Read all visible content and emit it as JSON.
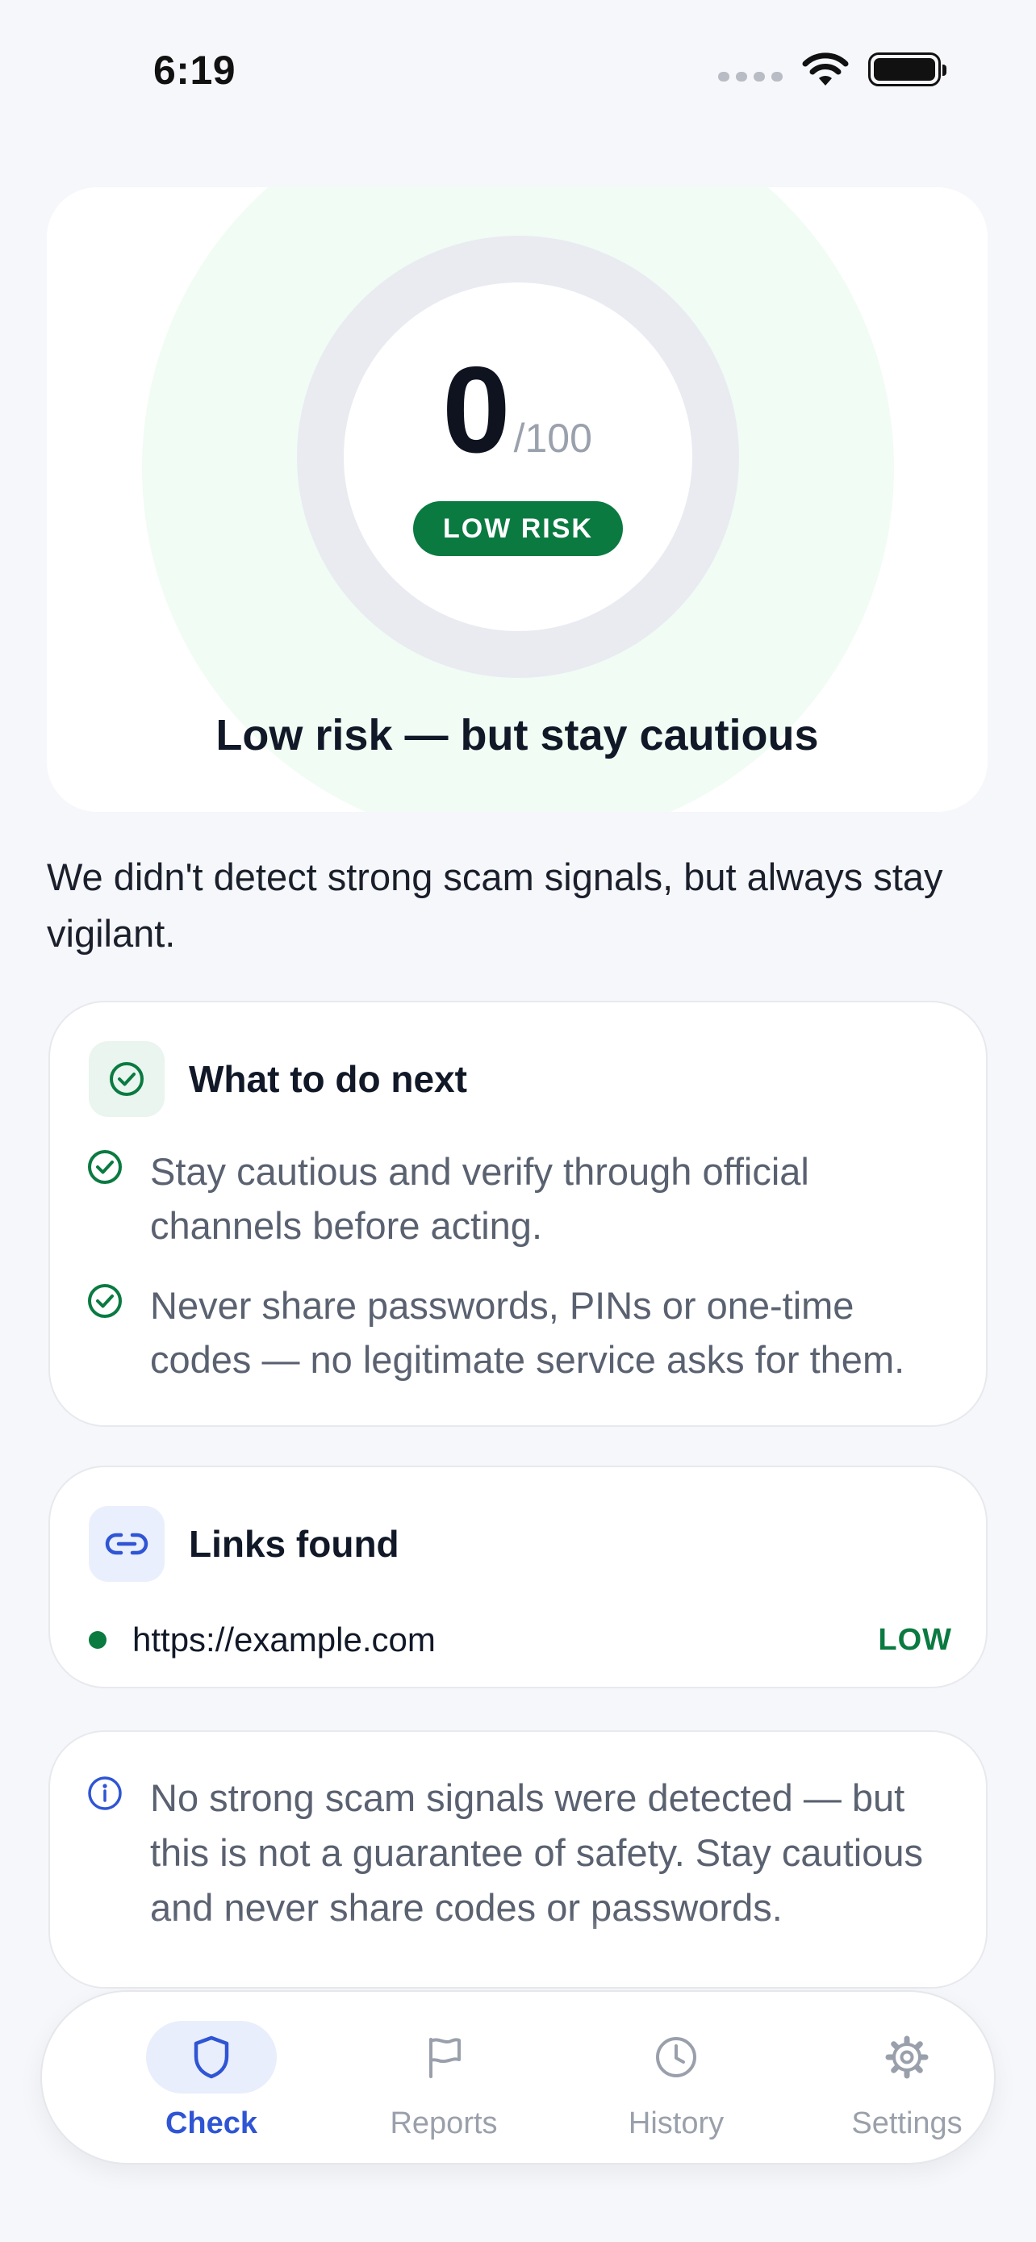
{
  "status_bar": {
    "time": "6:19"
  },
  "score": {
    "value": "0",
    "max": "/100",
    "badge": "LOW RISK",
    "headline": "Low risk — but stay cautious"
  },
  "summary": "We didn't detect strong scam signals, but always stay vigilant.",
  "next_steps": {
    "title": "What to do next",
    "items": [
      "Stay cautious and verify through official channels before acting.",
      "Never share passwords, PINs or one-time codes — no legitimate service asks for them."
    ]
  },
  "links": {
    "title": "Links found",
    "items": [
      {
        "url": "https://example.com",
        "level": "LOW"
      }
    ]
  },
  "info": {
    "text": "No strong scam signals were detected — but this is not a guarantee of safety. Stay cautious and never share codes or passwords."
  },
  "tabs": [
    {
      "label": "Check",
      "icon": "shield-icon",
      "active": true
    },
    {
      "label": "Reports",
      "icon": "flag-icon",
      "active": false
    },
    {
      "label": "History",
      "icon": "clock-icon",
      "active": false
    },
    {
      "label": "Settings",
      "icon": "gear-icon",
      "active": false
    }
  ],
  "colors": {
    "accent_green": "#0a7a41",
    "accent_blue": "#2f55d4",
    "background": "#f6f7fa"
  }
}
